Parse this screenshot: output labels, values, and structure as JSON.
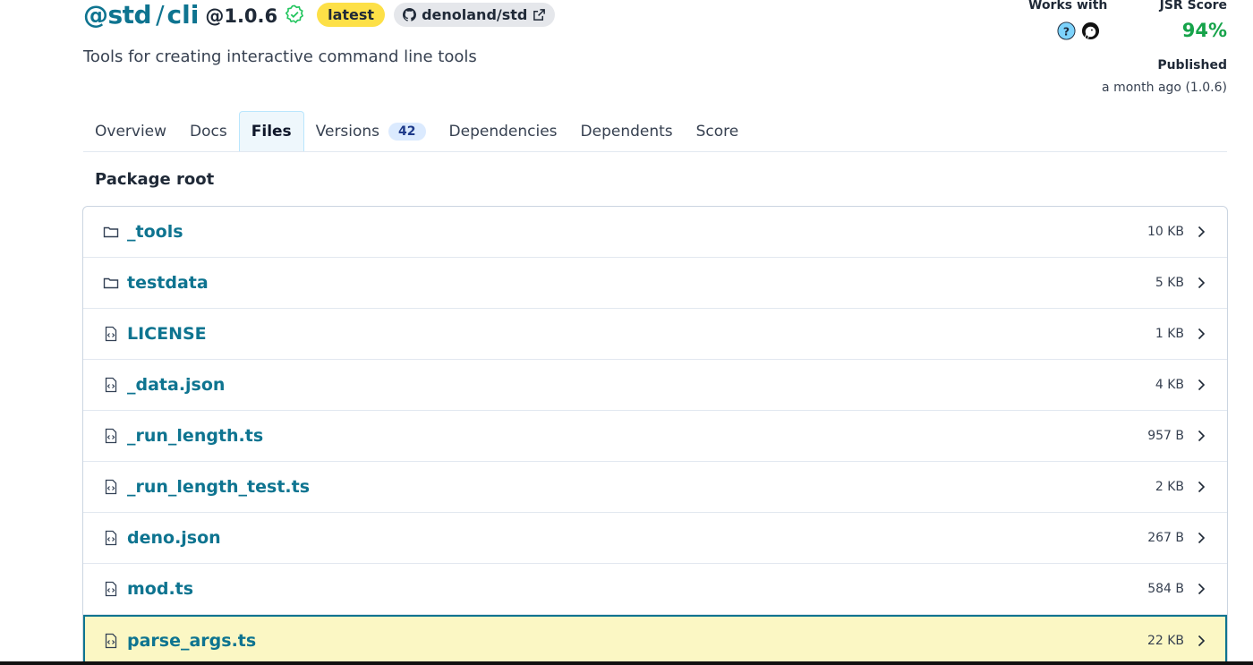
{
  "header": {
    "scope": "@std",
    "slash": "/",
    "package": "cli",
    "version": "@1.0.6",
    "badge_latest": "latest",
    "repo": "denoland/std",
    "description": "Tools for creating interactive command line tools"
  },
  "meta": {
    "works_with_label": "Works with",
    "score_label": "JSR Score",
    "score_value": "94%",
    "published_label": "Published",
    "published_value": "a month ago (1.0.6)"
  },
  "tabs": [
    {
      "label": "Overview"
    },
    {
      "label": "Docs"
    },
    {
      "label": "Files",
      "active": true
    },
    {
      "label": "Versions",
      "count": "42"
    },
    {
      "label": "Dependencies"
    },
    {
      "label": "Dependents"
    },
    {
      "label": "Score"
    }
  ],
  "section_title": "Package root",
  "files": [
    {
      "name": "_tools",
      "size": "10 KB",
      "type": "folder"
    },
    {
      "name": "testdata",
      "size": "5 KB",
      "type": "folder"
    },
    {
      "name": "LICENSE",
      "size": "1 KB",
      "type": "file"
    },
    {
      "name": "_data.json",
      "size": "4 KB",
      "type": "file"
    },
    {
      "name": "_run_length.ts",
      "size": "957 B",
      "type": "file"
    },
    {
      "name": "_run_length_test.ts",
      "size": "2 KB",
      "type": "file"
    },
    {
      "name": "deno.json",
      "size": "267 B",
      "type": "file"
    },
    {
      "name": "mod.ts",
      "size": "584 B",
      "type": "file"
    },
    {
      "name": "parse_args.ts",
      "size": "22 KB",
      "type": "file",
      "highlighted": true
    }
  ],
  "colors": {
    "accent": "#0e7490",
    "score": "#16a34a",
    "latest_badge": "#fde047",
    "highlight_row": "#fbf7c4"
  },
  "icons": {
    "verified": "verified-check-icon",
    "repo": "github-icon",
    "external": "external-link-icon",
    "folder": "folder-icon",
    "file": "file-code-icon",
    "chevron": "chevron-right-icon"
  }
}
